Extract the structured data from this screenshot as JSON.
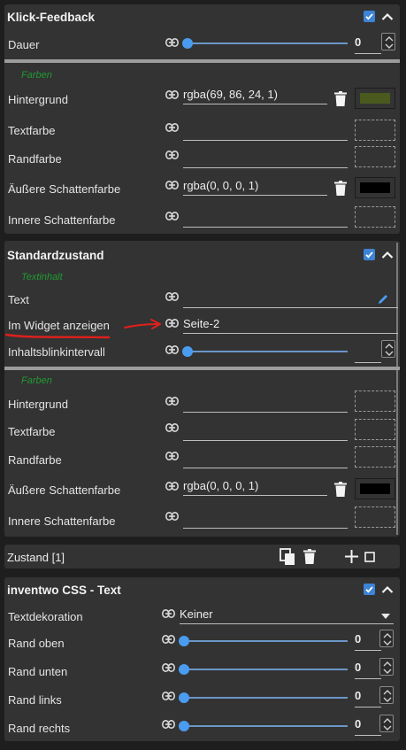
{
  "klick_feedback": {
    "title": "Klick-Feedback",
    "dauer": {
      "label": "Dauer",
      "value": "0"
    },
    "group": "Farben",
    "hintergrund": {
      "label": "Hintergrund",
      "value": "rgba(69, 86, 24, 1)",
      "swatch": "#4a5a1e"
    },
    "textfarbe": {
      "label": "Textfarbe",
      "value": ""
    },
    "randfarbe": {
      "label": "Randfarbe",
      "value": ""
    },
    "aussere": {
      "label": "Äußere Schattenfarbe",
      "value": "rgba(0, 0, 0, 1)",
      "swatch": "#000000"
    },
    "innere": {
      "label": "Innere Schattenfarbe",
      "value": ""
    }
  },
  "standardzustand": {
    "title": "Standardzustand",
    "group_text": "Textinhalt",
    "text": {
      "label": "Text",
      "value": ""
    },
    "widget": {
      "label": "Im Widget anzeigen",
      "value": "Seite-2"
    },
    "blink": {
      "label": "Inhaltsblinkintervall",
      "value": ""
    },
    "group_colors": "Farben",
    "hintergrund": {
      "label": "Hintergrund",
      "value": ""
    },
    "textfarbe": {
      "label": "Textfarbe",
      "value": ""
    },
    "randfarbe": {
      "label": "Randfarbe",
      "value": ""
    },
    "aussere": {
      "label": "Äußere Schattenfarbe",
      "value": "rgba(0, 0, 0, 1)",
      "swatch": "#000000"
    },
    "innere": {
      "label": "Innere Schattenfarbe",
      "value": ""
    }
  },
  "zustand_bar": {
    "label": "Zustand [1]"
  },
  "inventwo": {
    "title": "inventwo CSS - Text",
    "textdekoration": {
      "label": "Textdekoration",
      "value": "Keiner"
    },
    "rand_oben": {
      "label": "Rand oben",
      "value": "0"
    },
    "rand_unten": {
      "label": "Rand unten",
      "value": "0"
    },
    "rand_links": {
      "label": "Rand links",
      "value": "0"
    },
    "rand_rechts": {
      "label": "Rand rechts",
      "value": "0"
    }
  },
  "colors": {
    "accent": "#3d84d6",
    "group": "#1f9a32",
    "annotation": "#e0201c"
  }
}
